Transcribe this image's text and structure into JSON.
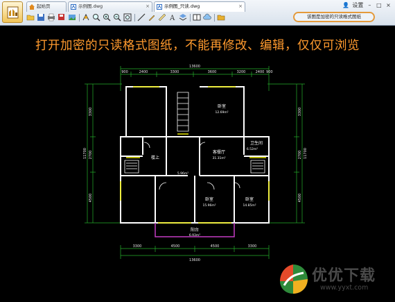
{
  "tabs": [
    {
      "label": "起始页",
      "closable": false
    },
    {
      "label": "示例图.dwg",
      "closable": true
    },
    {
      "label": "示例图_只读.dwg",
      "closable": true
    }
  ],
  "window_controls": {
    "user": "👤",
    "settings": "设置",
    "min": "–",
    "max": "□",
    "close": "×"
  },
  "toolbar_icons": [
    "open-icon",
    "save-icon",
    "print-icon",
    "save-as-icon",
    "image-icon",
    "pan-icon",
    "zoom-window-icon",
    "zoom-in-icon",
    "zoom-out-icon",
    "zoom-extents-icon",
    "line-icon",
    "pen-icon",
    "measure-icon",
    "text-icon",
    "layer-icon",
    "layout-icon",
    "cloud-icon",
    "folder-icon"
  ],
  "status_pill": "该图是加密的只读格式图纸",
  "headline": "打开加密的只读格式图纸，不能再修改、编辑，仅仅可浏览",
  "plan": {
    "top_total": "13600",
    "top_dims": [
      "900",
      "2400",
      "3300",
      "3600",
      "3200",
      "2400",
      "900"
    ],
    "bottom_dims": [
      "3300",
      "4500",
      "4500",
      "3300"
    ],
    "bottom_total": "13600",
    "left_dims": [
      "3300",
      "2700",
      "4500"
    ],
    "left_total": "11700",
    "right_dims": [
      "3300",
      "2700",
      "4500"
    ],
    "right_total": "11700",
    "rooms": [
      {
        "name": "卧室",
        "area": "12.69m²"
      },
      {
        "name": "客餐厅",
        "area": "31.31m²"
      },
      {
        "name": "卫生间",
        "area": "6.52m²"
      },
      {
        "name": "楼上",
        "area": ""
      },
      {
        "name": "卧室",
        "area": "15.96m²"
      },
      {
        "name": "卧室",
        "area": "14.85m²"
      },
      {
        "name": "阳台",
        "area": "6.93m²"
      },
      {
        "name": "",
        "area": "5.96m²"
      }
    ]
  },
  "watermark": {
    "text": "优优下载",
    "url": "www.yyxt.com"
  },
  "colors": {
    "headline": "#ff9a2e",
    "pill_border": "#e49a3b",
    "walls": "#ffffff",
    "dims": "#26b02c",
    "yellow_lines": "#e8e800",
    "balcony": "#c43cc4"
  }
}
